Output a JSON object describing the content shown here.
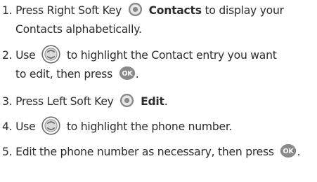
{
  "steps": [
    {
      "number": "1.",
      "text_a": "Press Right Soft Key",
      "bold": "Contacts",
      "text_b": "to display your",
      "text_c": "Contacts alphabetically.",
      "icon": "soft-key-icon"
    },
    {
      "number": "2.",
      "text_a": "Use",
      "text_b": "to highlight the Contact entry you want",
      "text_c": "to edit, then press",
      "text_d": ".",
      "icons": [
        "navigation-key-icon",
        "ok-key-icon"
      ]
    },
    {
      "number": "3.",
      "text_a": "Press Left Soft Key",
      "bold": "Edit",
      "text_b": ".",
      "icon": "soft-key-icon"
    },
    {
      "number": "4.",
      "text_a": "Use",
      "text_b": "to highlight the phone number.",
      "icon": "navigation-key-icon"
    },
    {
      "number": "5.",
      "text_a": "Edit the phone number as necessary, then press",
      "text_b": ".",
      "icon": "ok-key-icon",
      "ok_label": "OK"
    }
  ],
  "colors": {
    "text": "#2b2b2b",
    "icon_gray": "#7a7a7a",
    "icon_light": "#d4d4d4"
  }
}
